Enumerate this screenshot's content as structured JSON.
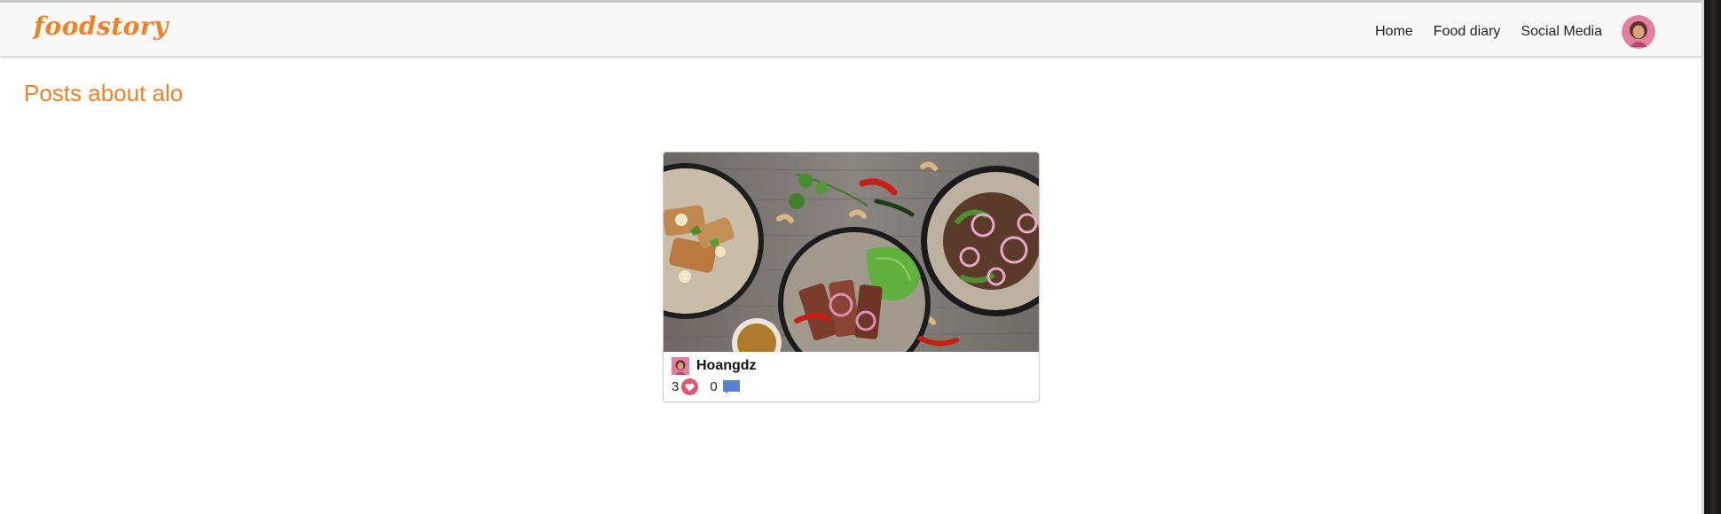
{
  "colors": {
    "brand": "#f08026",
    "heart": "#e05670",
    "comment": "#5b80d8",
    "avatar_bg": "#e27fa2"
  },
  "header": {
    "brand": "foodstory",
    "nav": [
      {
        "label": "Home"
      },
      {
        "label": "Food diary"
      },
      {
        "label": "Social Media"
      }
    ],
    "user_avatar_icon": "user-avatar-icon"
  },
  "main": {
    "title": "Posts about alo",
    "posts": [
      {
        "author": "Hoangdz",
        "likes": "3",
        "comments": "0",
        "image_icon": "food-photo",
        "like_icon": "heart-icon",
        "comment_icon": "comment-icon"
      }
    ]
  }
}
